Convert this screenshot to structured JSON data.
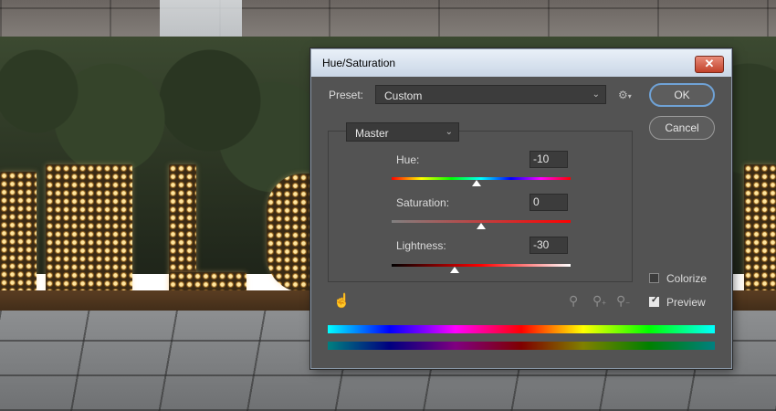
{
  "dialog": {
    "title": "Hue/Saturation",
    "close_icon": "close-icon",
    "preset": {
      "label": "Preset:",
      "value": "Custom",
      "settings_icon": "gear-icon"
    },
    "buttons": {
      "ok": "OK",
      "cancel": "Cancel"
    },
    "channel": {
      "value": "Master"
    },
    "adjustments": {
      "hue": {
        "label": "Hue:",
        "value": "-10",
        "range": [
          -180,
          180
        ]
      },
      "saturation": {
        "label": "Saturation:",
        "value": "0",
        "range": [
          -100,
          100
        ]
      },
      "lightness": {
        "label": "Lightness:",
        "value": "-30",
        "range": [
          -100,
          100
        ]
      }
    },
    "options": {
      "colorize": {
        "label": "Colorize",
        "checked": false
      },
      "preview": {
        "label": "Preview",
        "checked": true
      }
    },
    "tools": {
      "targeted_adjustment": "hand-pointer-icon",
      "eyedroppers": [
        "eyedropper-icon",
        "eyedropper-plus-icon",
        "eyedropper-minus-icon"
      ]
    },
    "colors": {
      "accent": "#6fa2d6",
      "panel": "#535353",
      "title_bar": "#dce5f0",
      "close": "#c8412b"
    }
  }
}
